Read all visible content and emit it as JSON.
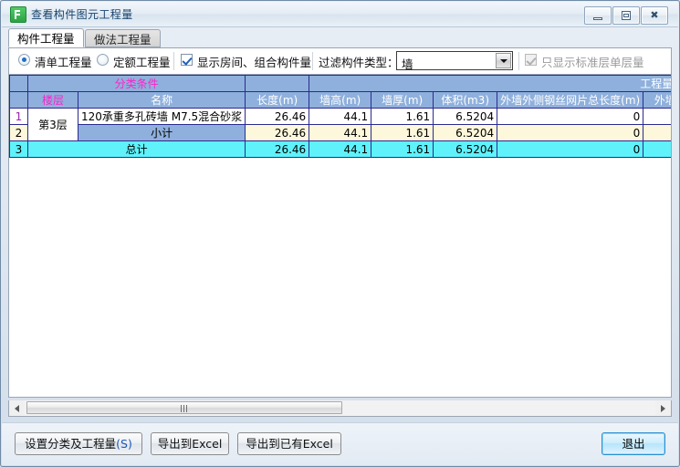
{
  "window": {
    "title": "查看构件图元工程量",
    "icon": "app-icon",
    "controls": {
      "minimize": "minimize-icon",
      "maximize": "maximize-icon",
      "close": "close-icon"
    }
  },
  "tabs": [
    {
      "label": "构件工程量",
      "active": true
    },
    {
      "label": "做法工程量",
      "active": false
    }
  ],
  "options": {
    "radio_list_label": "清单工程量",
    "radio_quota_label": "定额工程量",
    "radio_selected": "清单工程量",
    "show_room_checkbox_label": "显示房间、组合构件量",
    "show_room_checked": true,
    "filter_label": "过滤构件类型：",
    "filter_value": "墙",
    "standard_floor_checkbox_label": "只显示标准层单层量",
    "standard_floor_checked": true,
    "standard_floor_disabled": true
  },
  "grid": {
    "group_headers": [
      {
        "label": "",
        "span": 1
      },
      {
        "label": "分类条件",
        "span": 2
      },
      {
        "label": "",
        "span": 1
      },
      {
        "label": "工程量名称",
        "span": 5
      }
    ],
    "columns": [
      "",
      "楼层",
      "名称",
      "长度(m)",
      "墙高(m)",
      "墙厚(m)",
      "体积(m3)",
      "外墙外侧钢丝网片总长度(m)",
      "外墙内"
    ],
    "rows": [
      {
        "num": "1",
        "type": "data",
        "floor": "第3层",
        "name": "120承重多孔砖墙 M7.5混合砂浆",
        "length": "26.46",
        "wall_height": "44.1",
        "wall_thickness": "1.61",
        "volume": "6.5204",
        "mesh_length": "0",
        "inner": ""
      },
      {
        "num": "2",
        "type": "subtotal",
        "floor": "",
        "name": "小计",
        "length": "26.46",
        "wall_height": "44.1",
        "wall_thickness": "1.61",
        "volume": "6.5204",
        "mesh_length": "0",
        "inner": ""
      },
      {
        "num": "3",
        "type": "total",
        "floor": "",
        "name": "总计",
        "length": "26.46",
        "wall_height": "44.1",
        "wall_thickness": "1.61",
        "volume": "6.5204",
        "mesh_length": "0",
        "inner": ""
      }
    ]
  },
  "scrollbar": {
    "left_arrow": "scroll-left-icon",
    "right_arrow": "scroll-right-icon"
  },
  "footer": {
    "settings_button": "设置分类及工程量",
    "settings_button_accel": "(S)",
    "export_excel_button": "导出到Excel",
    "export_existing_excel_button": "导出到已有Excel",
    "exit_button": "退出"
  },
  "colors": {
    "header_bg": "#8fb0dc",
    "header_text": "#ff22cc",
    "subtotal_bg": "#fdf8db",
    "total_bg": "#5ff2fb",
    "accent": "#1b57b5"
  }
}
